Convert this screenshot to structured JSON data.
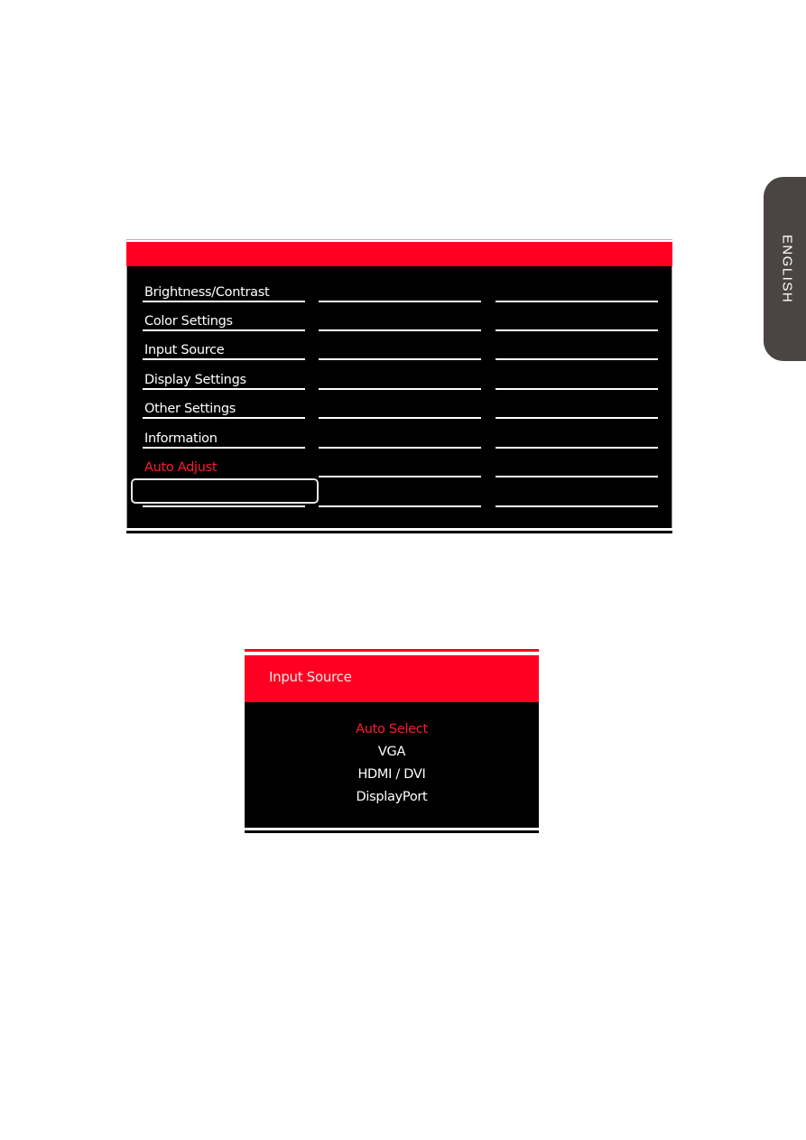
{
  "side_tab": {
    "label": "ENGLISH"
  },
  "main_menu": {
    "header_color": "#ff0022",
    "selected_color": "#ff1a2e",
    "items": [
      {
        "label": "Brightness/Contrast",
        "selected": false
      },
      {
        "label": "Color Settings",
        "selected": false
      },
      {
        "label": "Input Source",
        "selected": false
      },
      {
        "label": "Display Settings",
        "selected": false
      },
      {
        "label": "Other Settings",
        "selected": false
      },
      {
        "label": "Information",
        "selected": false
      },
      {
        "label": "Auto Adjust",
        "selected": true
      },
      {
        "label": "",
        "selected": false
      }
    ]
  },
  "input_source_menu": {
    "title": "Input Source",
    "options": [
      {
        "label": "Auto Select",
        "selected": true
      },
      {
        "label": "VGA",
        "selected": false
      },
      {
        "label": "HDMI / DVI",
        "selected": false
      },
      {
        "label": "DisplayPort",
        "selected": false
      }
    ]
  }
}
